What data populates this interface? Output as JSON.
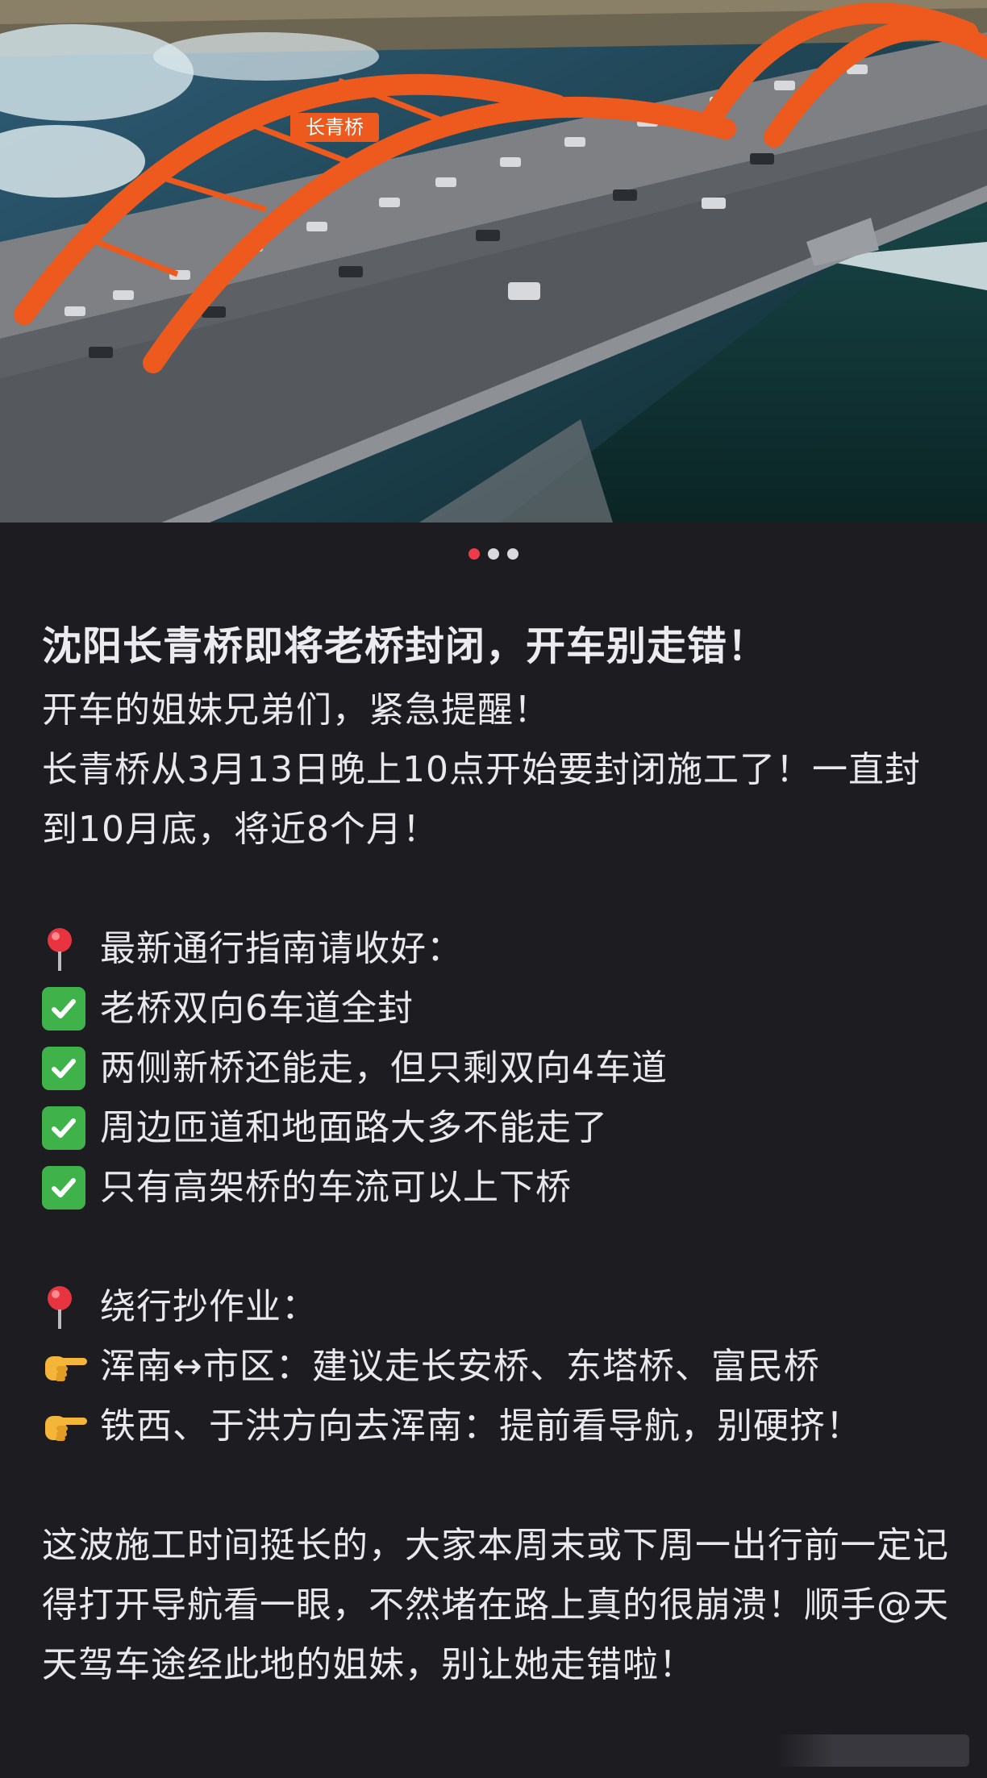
{
  "post": {
    "carousel": {
      "total": 3,
      "active": 0
    },
    "bridge_sign": "长青桥",
    "title": "沈阳长青桥即将老桥封闭，开车别走错！",
    "intro": [
      "开车的姐妹兄弟们，紧急提醒！",
      "长青桥从3月13日晚上10点开始要封闭施工了！一直封到10月底，将近8个月！"
    ],
    "guide": {
      "icon": "pin-icon",
      "heading": "最新通行指南请收好：",
      "items": [
        "老桥双向6车道全封",
        "两侧新桥还能走，但只剩双向4车道",
        "周边匝道和地面路大多不能走了",
        "只有高架桥的车流可以上下桥"
      ],
      "item_icon": "check-mark-icon"
    },
    "detour": {
      "icon": "pin-icon",
      "heading": "绕行抄作业：",
      "items": [
        "浑南↔市区：建议走长安桥、东塔桥、富民桥",
        "铁西、于洪方向去浑南：提前看导航，别硬挤！"
      ],
      "item_icon": "pointing-hand-icon"
    },
    "closing": "这波施工时间挺长的，大家本周末或下周一出行前一定记得打开导航看一眼，不然堵在路上真的很崩溃！顺手@天天驾车途经此地的姐妹，别让她走错啦！"
  },
  "colors": {
    "background": "#1c1c21",
    "text": "#e9e9ec",
    "active_dot": "#ee3b4a",
    "inactive_dot": "#d9d9de",
    "check_green": "#3fb24a",
    "bridge_orange": "#ee5a1e"
  }
}
